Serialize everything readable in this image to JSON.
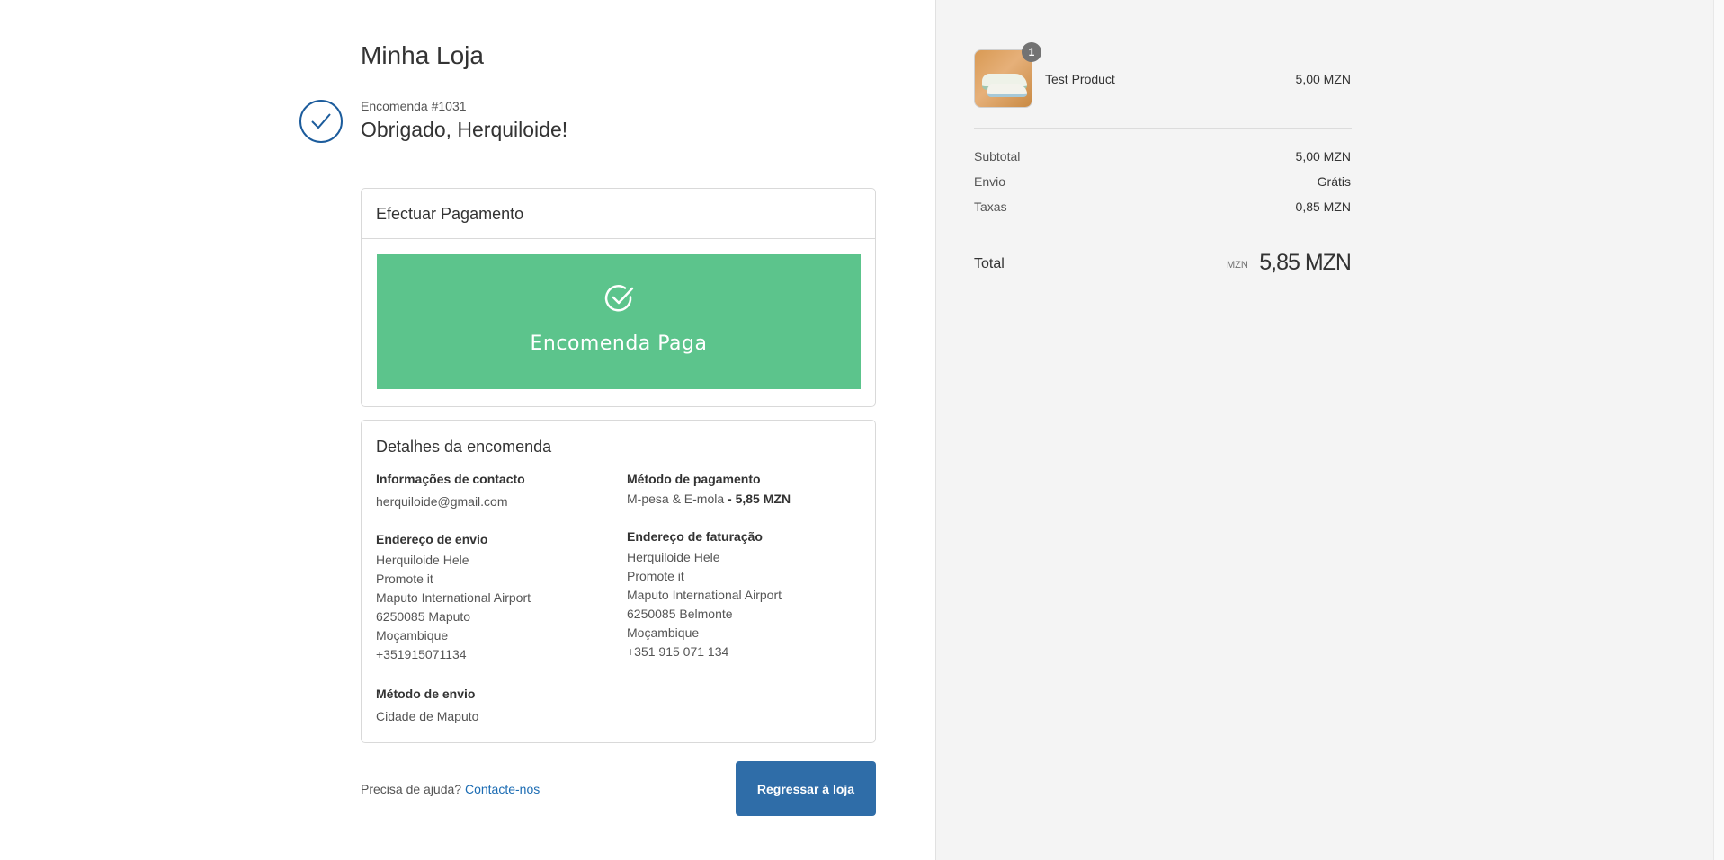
{
  "store": {
    "title": "Minha Loja"
  },
  "order": {
    "number": "Encomenda #1031",
    "thanks": "Obrigado, Herquiloide!"
  },
  "payment_card": {
    "heading": "Efectuar Pagamento",
    "status": "Encomenda Paga",
    "status_color": "#5cc48c"
  },
  "details": {
    "heading": "Detalhes da encomenda",
    "contact_label": "Informações de contacto",
    "contact_email": "herquiloide@gmail.com",
    "shipping_address_label": "Endereço de envio",
    "shipping_address": [
      "Herquiloide Hele",
      "Promote it",
      "Maputo International Airport",
      "6250085 Maputo",
      "Moçambique",
      "+351915071134"
    ],
    "shipping_method_label": "Método de envio",
    "shipping_method": "Cidade de Maputo",
    "payment_method_label": "Método de pagamento",
    "payment_method": "M-pesa & E-mola",
    "payment_amount": "- 5,85 MZN",
    "billing_address_label": "Endereço de faturação",
    "billing_address": [
      "Herquiloide Hele",
      "Promote it",
      "Maputo International Airport",
      "6250085 Belmonte",
      "Moçambique",
      "+351 915 071 134"
    ]
  },
  "footer": {
    "help_text": "Precisa de ajuda?",
    "help_link": "Contacte-nos",
    "back_button": "Regressar à loja",
    "button_color": "#2f6da8"
  },
  "summary": {
    "product": {
      "name": "Test Product",
      "price": "5,00 MZN",
      "quantity": "1"
    },
    "subtotal_label": "Subtotal",
    "subtotal": "5,00 MZN",
    "shipping_label": "Envio",
    "shipping": "Grátis",
    "taxes_label": "Taxas",
    "taxes": "0,85 MZN",
    "total_label": "Total",
    "total_currency": "MZN",
    "total": "5,85 MZN"
  },
  "icons": {
    "order_confirmed": "check-icon",
    "paid": "check-circle-icon"
  }
}
